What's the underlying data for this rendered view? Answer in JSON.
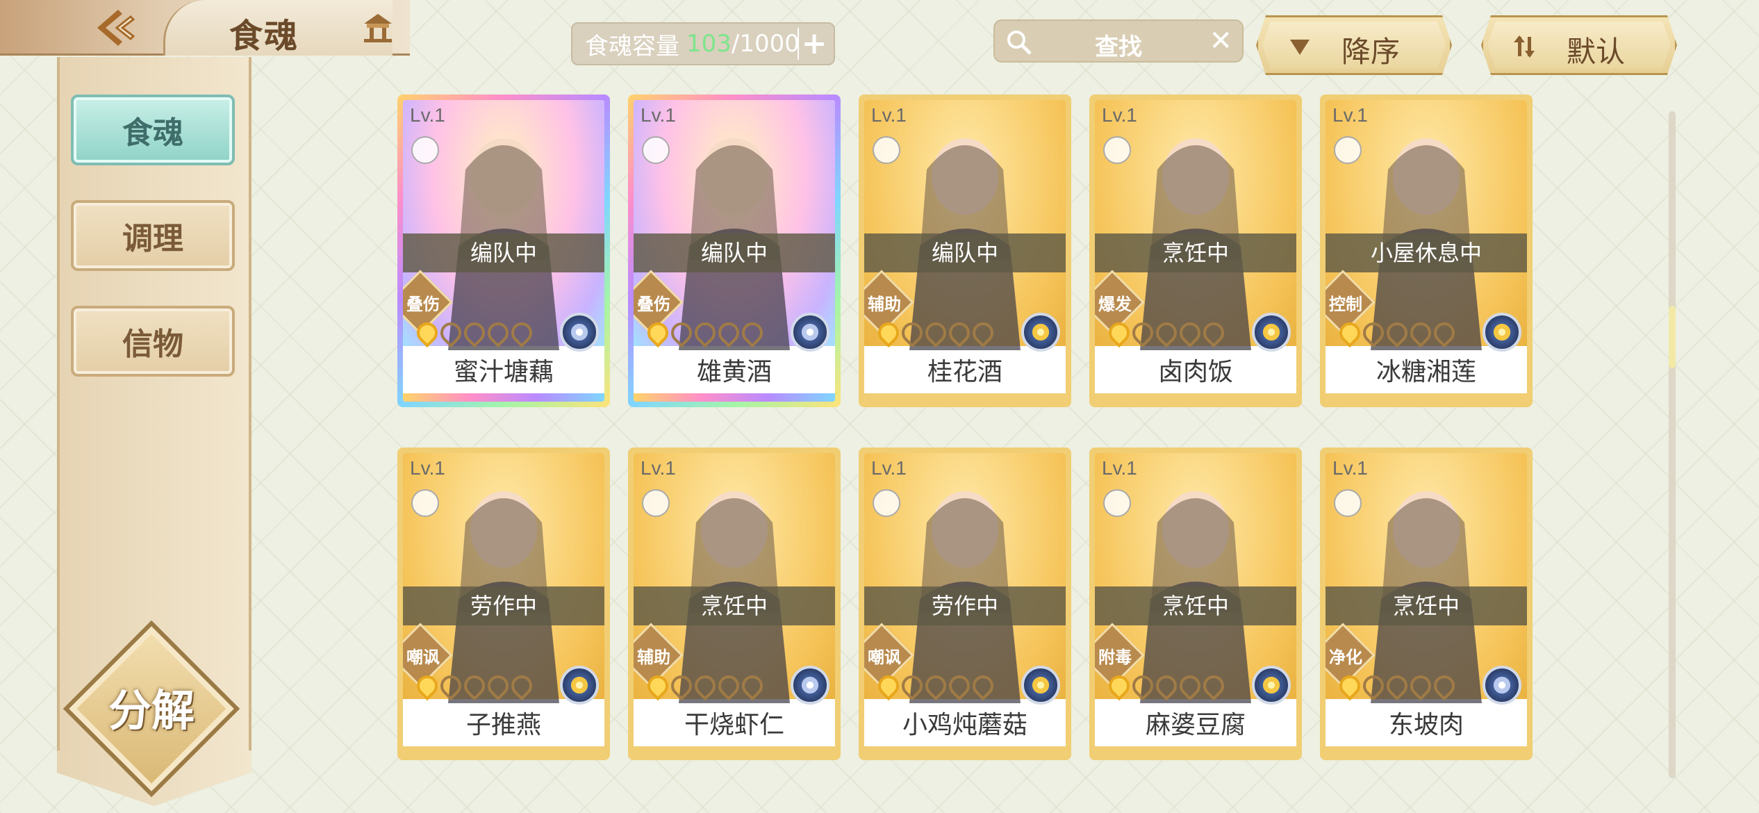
{
  "header": {
    "title": "食魂",
    "capacity_label": "食魂容量",
    "capacity_current": "103",
    "capacity_max": "/1000",
    "capacity_add": "+"
  },
  "search": {
    "placeholder": "查找",
    "clear": "✕"
  },
  "sort": {
    "order_label": "降序",
    "mode_label": "默认"
  },
  "sidebar": {
    "items": [
      {
        "label": "食魂",
        "active": true
      },
      {
        "label": "调理",
        "active": false
      },
      {
        "label": "信物",
        "active": false
      }
    ],
    "decompose_label": "分解"
  },
  "cards": [
    {
      "level": "Lv.1",
      "status": "编队中",
      "role": "叠伤",
      "name": "蜜汁塘藕",
      "stars": 1,
      "element": "blue",
      "frame": "rainbow"
    },
    {
      "level": "Lv.1",
      "status": "编队中",
      "role": "叠伤",
      "name": "雄黄酒",
      "stars": 1,
      "element": "blue",
      "frame": "rainbow"
    },
    {
      "level": "Lv.1",
      "status": "编队中",
      "role": "辅助",
      "name": "桂花酒",
      "stars": 1,
      "element": "gold",
      "frame": "gold"
    },
    {
      "level": "Lv.1",
      "status": "烹饪中",
      "role": "爆发",
      "name": "卤肉饭",
      "stars": 1,
      "element": "gold",
      "frame": "gold"
    },
    {
      "level": "Lv.1",
      "status": "小屋休息中",
      "role": "控制",
      "name": "冰糖湘莲",
      "stars": 1,
      "element": "gold",
      "frame": "gold"
    },
    {
      "level": "Lv.1",
      "status": "劳作中",
      "role": "嘲讽",
      "name": "子推燕",
      "stars": 1,
      "element": "gold",
      "frame": "gold"
    },
    {
      "level": "Lv.1",
      "status": "烹饪中",
      "role": "辅助",
      "name": "干烧虾仁",
      "stars": 1,
      "element": "blue",
      "frame": "gold"
    },
    {
      "level": "Lv.1",
      "status": "劳作中",
      "role": "嘲讽",
      "name": "小鸡炖蘑菇",
      "stars": 1,
      "element": "gold",
      "frame": "gold"
    },
    {
      "level": "Lv.1",
      "status": "烹饪中",
      "role": "附毒",
      "name": "麻婆豆腐",
      "stars": 1,
      "element": "gold",
      "frame": "gold"
    },
    {
      "level": "Lv.1",
      "status": "烹饪中",
      "role": "净化",
      "name": "东坡肉",
      "stars": 1,
      "element": "blue",
      "frame": "gold"
    }
  ],
  "colors": {
    "active_tab": "#8fd3c7",
    "capacity_current": "#7de58b",
    "card_frame": "#f1ce73"
  }
}
